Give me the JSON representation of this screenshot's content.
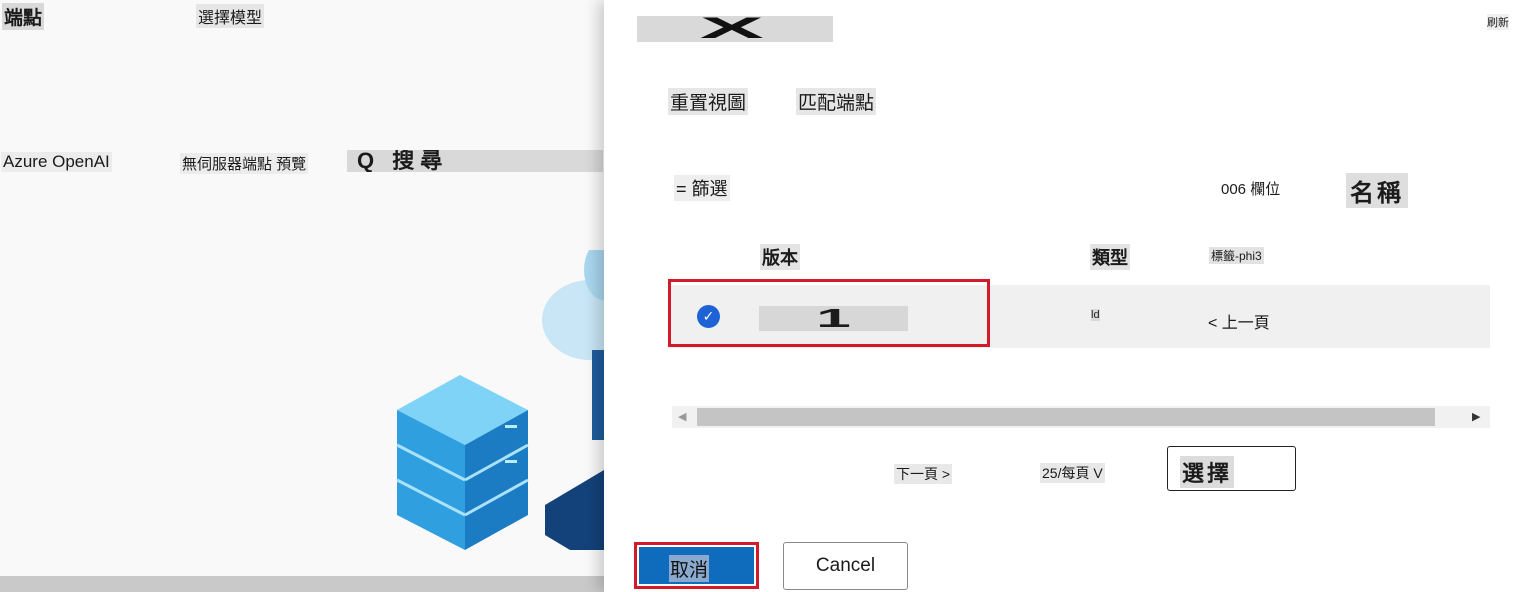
{
  "background": {
    "breadcrumb": {
      "current": "端點",
      "step": "選擇模型"
    },
    "provider": "Azure OpenAI",
    "serverless": "無伺服器端點 預覽",
    "search_label": "Q 搜尋"
  },
  "panel": {
    "title": "X",
    "refresh": "刷新",
    "toolbar": {
      "reset_view": "重置視圖",
      "match_endpoint": "匹配端點"
    },
    "filter": "= 篩選",
    "columns": "006 欄位",
    "sort": "名稱",
    "table": {
      "headers": {
        "version": "版本",
        "type": "類型",
        "tag": "標籤-phi3"
      },
      "rows": [
        {
          "selected": true,
          "version": "1",
          "type": "ld",
          "action": "< 上一頁"
        }
      ]
    },
    "pagination": {
      "next": "下一頁 >",
      "per_page": "25/每頁 V"
    },
    "select_button": "選擇",
    "footer": {
      "primary": "取消",
      "secondary": "Cancel"
    }
  },
  "colors": {
    "primary": "#0f6cbd",
    "highlight_border": "#d11a2a",
    "check": "#1e63d6"
  }
}
